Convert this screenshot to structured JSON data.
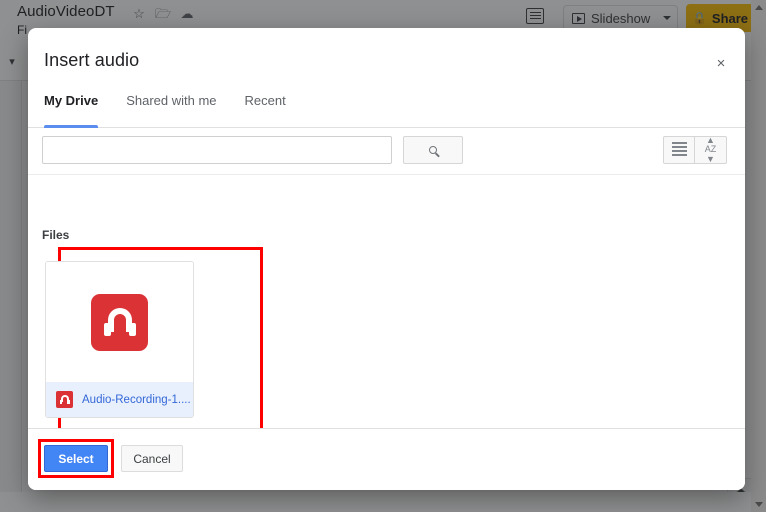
{
  "background": {
    "doc_title": "AudioVideoDT",
    "menu_first": "Fi",
    "icons": {
      "star": "star-icon",
      "move_to_folder": "move-to-folder-icon",
      "cloud_saved": "cloud-saved-icon",
      "present_mode": "present-mode-icon",
      "explore": "explore-icon"
    },
    "slideshow_label": "Slideshow",
    "share_label": "Share",
    "lock_glyph": " ",
    "status_text": ""
  },
  "dialog": {
    "title": "Insert audio",
    "close_label": "×",
    "tabs": [
      {
        "label": "My Drive",
        "active": true
      },
      {
        "label": "Shared with me",
        "active": false
      },
      {
        "label": "Recent",
        "active": false
      }
    ],
    "search": {
      "value": "",
      "placeholder": "",
      "button_icon": "search-icon"
    },
    "view_controls": [
      {
        "icon": "list-view-icon"
      },
      {
        "icon": "sort-az-icon"
      }
    ],
    "files_section_label": "Files",
    "files": [
      {
        "name": "Audio-Recording-1....",
        "type_icon": "audio-file-icon",
        "selected": true
      }
    ],
    "footer": {
      "select_label": "Select",
      "cancel_label": "Cancel"
    }
  },
  "annotations": {
    "accent_color": "#ff0000",
    "highlighted": [
      "file-card",
      "select-button"
    ]
  },
  "colors": {
    "primary_blue": "#4285f4",
    "link_blue": "#3367d6",
    "selection_blue": "#e8f0fe",
    "audio_red": "#db3236",
    "share_yellow": "#fbbc04",
    "tab_underline": "#5b8def"
  }
}
